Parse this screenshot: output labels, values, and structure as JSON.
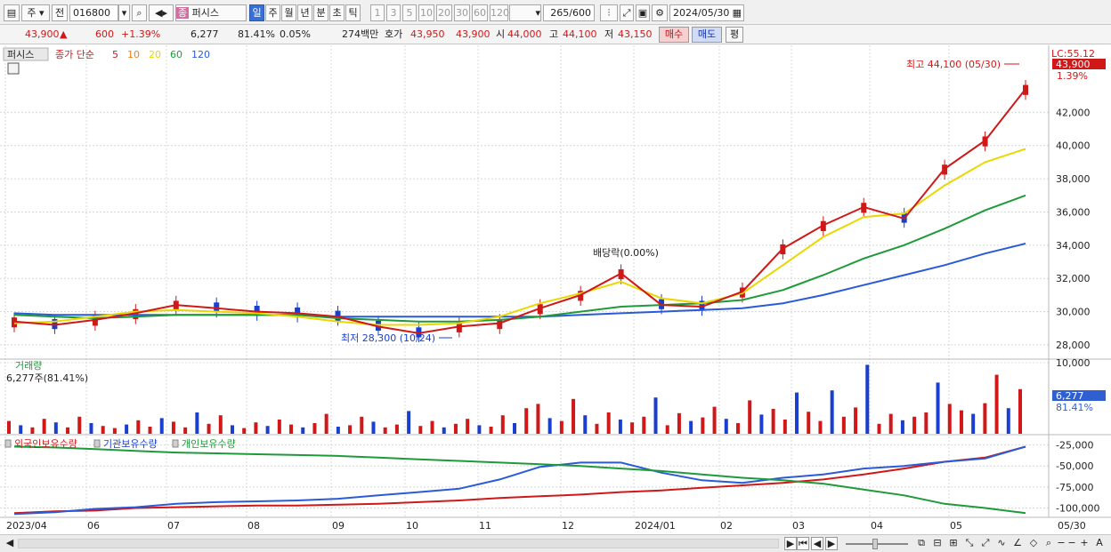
{
  "toolbar": {
    "type_select": "주",
    "prev_label": "전",
    "code": "016800",
    "name": "퍼시스",
    "periods": [
      "일",
      "주",
      "월",
      "년",
      "분",
      "초",
      "틱"
    ],
    "nums": [
      "1",
      "3",
      "5",
      "10",
      "20",
      "30",
      "60",
      "120"
    ],
    "count": "265",
    "count_max": "/600",
    "date": "2024/05/30"
  },
  "quote": {
    "price": "43,900",
    "arrow": "▲",
    "change": "600",
    "pct": "+1.39%",
    "volume": "6,277",
    "vol_ratio": "81.41%",
    "turnover": "0.05%",
    "amount": "274백만",
    "hoga_label": "호가",
    "ask": "43,950",
    "bid": "43,900",
    "open_label": "시",
    "open": "44,000",
    "high_label": "고",
    "high": "44,100",
    "low_label": "저",
    "low": "43,150",
    "buy": "매수",
    "sell": "매도",
    "flat": "평"
  },
  "legend": {
    "name": "퍼시스",
    "close_label": "종가 단순",
    "ma_labels": [
      {
        "label": "5",
        "color": "#d01818"
      },
      {
        "label": "10",
        "color": "#f08020"
      },
      {
        "label": "20",
        "color": "#e8d800"
      },
      {
        "label": "60",
        "color": "#1f9a3a"
      },
      {
        "label": "120",
        "color": "#2a5ad8"
      }
    ]
  },
  "annotations": {
    "high": "최고 44,100 (05/30)",
    "low": "최저 28,300 (10/24)",
    "dividend": "배당락(0.00%)",
    "lc": "LC:55.12",
    "last_price": "43,900",
    "last_pct": "1.39%"
  },
  "volume_panel": {
    "title": "거래량",
    "subtitle": "6,277주(81.41%)",
    "last": "6,277",
    "last_pct": "81.41%"
  },
  "holder_panel": {
    "labels": [
      {
        "label": "외국인보유수량",
        "color": "#d01818"
      },
      {
        "label": "기관보유수량",
        "color": "#1a3fd0"
      },
      {
        "label": "개인보유수량",
        "color": "#1f9a3a"
      }
    ]
  },
  "chart_data": [
    {
      "type": "line",
      "title": "",
      "y_ticks": [
        "42,000",
        "40,000",
        "38,000",
        "36,000",
        "34,000",
        "32,000",
        "30,000",
        "28,000"
      ],
      "ylim": [
        27300,
        45500
      ],
      "x_ticks": [
        "2023/04",
        "06",
        "07",
        "08",
        "09",
        "10",
        "11",
        "12",
        "2024/01",
        "02",
        "03",
        "04",
        "05",
        "05/30"
      ],
      "series": [
        {
          "name": "5",
          "values": [
            29400,
            29200,
            29500,
            29900,
            30400,
            30200,
            30000,
            29900,
            29700,
            29100,
            28700,
            29100,
            29300,
            30200,
            31000,
            32300,
            30400,
            30300,
            31200,
            33800,
            35200,
            36300,
            35600,
            38600,
            40300,
            43400
          ]
        },
        {
          "name": "20",
          "values": [
            29300,
            29400,
            29700,
            30000,
            30100,
            30000,
            29900,
            29700,
            29400,
            29200,
            29200,
            29300,
            29700,
            30500,
            31100,
            31800,
            30800,
            30500,
            31100,
            32800,
            34500,
            35700,
            35900,
            37600,
            39000,
            39800
          ]
        },
        {
          "name": "60",
          "values": [
            29800,
            29700,
            29600,
            29700,
            29800,
            29800,
            29800,
            29800,
            29600,
            29500,
            29400,
            29400,
            29500,
            29700,
            30000,
            30300,
            30400,
            30500,
            30700,
            31300,
            32200,
            33200,
            34000,
            35000,
            36100,
            37000
          ]
        },
        {
          "name": "120",
          "values": [
            29900,
            29800,
            29800,
            29800,
            29800,
            29800,
            29800,
            29800,
            29700,
            29700,
            29700,
            29700,
            29700,
            29700,
            29800,
            29900,
            30000,
            30100,
            30200,
            30500,
            31000,
            31600,
            32200,
            32800,
            33500,
            34100
          ]
        }
      ]
    },
    {
      "type": "bar",
      "title": "",
      "y_ticks": [
        "10,000"
      ],
      "ylim": [
        0,
        10000
      ],
      "values": [
        1800,
        1200,
        900,
        2100,
        1600,
        900,
        2400,
        1500,
        1100,
        800,
        1300,
        1900,
        1000,
        2200,
        1700,
        900,
        3000,
        1400,
        2600,
        1200,
        800,
        1600,
        1100,
        2000,
        1300,
        900,
        1500,
        2800,
        1000,
        1200,
        2400,
        1700,
        900,
        1300,
        3200,
        1100,
        1800,
        900,
        1400,
        2100,
        1200,
        1000,
        2600,
        1500,
        3600,
        4200,
        2200,
        1800,
        4900,
        2600,
        1400,
        3000,
        2000,
        1600,
        2400,
        5100,
        1200,
        2900,
        1800,
        2300,
        3800,
        2100,
        1500,
        4700,
        2700,
        3500,
        2000,
        5800,
        3100,
        1800,
        6100,
        2400,
        3700,
        9700,
        1400,
        2800,
        1900,
        2400,
        3000,
        7200,
        4200,
        3300,
        2800,
        4300,
        8300,
        3600,
        6277
      ]
    },
    {
      "type": "line",
      "title": "",
      "y_ticks": [
        "-25,000",
        "-50,000",
        "-75,000",
        "-100,000"
      ],
      "ylim": [
        -110000,
        -17000
      ],
      "series": [
        {
          "name": "외국인보유수량",
          "values": [
            -106000,
            -104000,
            -103000,
            -100000,
            -99000,
            -98000,
            -97000,
            -97000,
            -96000,
            -95000,
            -93000,
            -91000,
            -88000,
            -86000,
            -84000,
            -81000,
            -79000,
            -76000,
            -73000,
            -70000,
            -66000,
            -60000,
            -53000,
            -45000,
            -40000,
            -27000
          ]
        },
        {
          "name": "기관보유수량",
          "values": [
            -107000,
            -105000,
            -101000,
            -99000,
            -95000,
            -93000,
            -92000,
            -91000,
            -89000,
            -85000,
            -81000,
            -77000,
            -66000,
            -51000,
            -46000,
            -46000,
            -58000,
            -67000,
            -70000,
            -64000,
            -60000,
            -53000,
            -50000,
            -45000,
            -41000,
            -27000
          ]
        },
        {
          "name": "개인보유수량",
          "values": [
            -27000,
            -28000,
            -30000,
            -32000,
            -34000,
            -35000,
            -36000,
            -37000,
            -38000,
            -40000,
            -42000,
            -44000,
            -46000,
            -48000,
            -50000,
            -53000,
            -56000,
            -60000,
            -64000,
            -67000,
            -71000,
            -78000,
            -85000,
            -95000,
            -100000,
            -106000
          ]
        }
      ]
    }
  ],
  "bottom": {
    "scroll_left": "◀",
    "nav": [
      "▶",
      "⏮",
      "◀",
      "▶"
    ],
    "zoom": [
      "−",
      "+"
    ],
    "a_label": "A"
  }
}
